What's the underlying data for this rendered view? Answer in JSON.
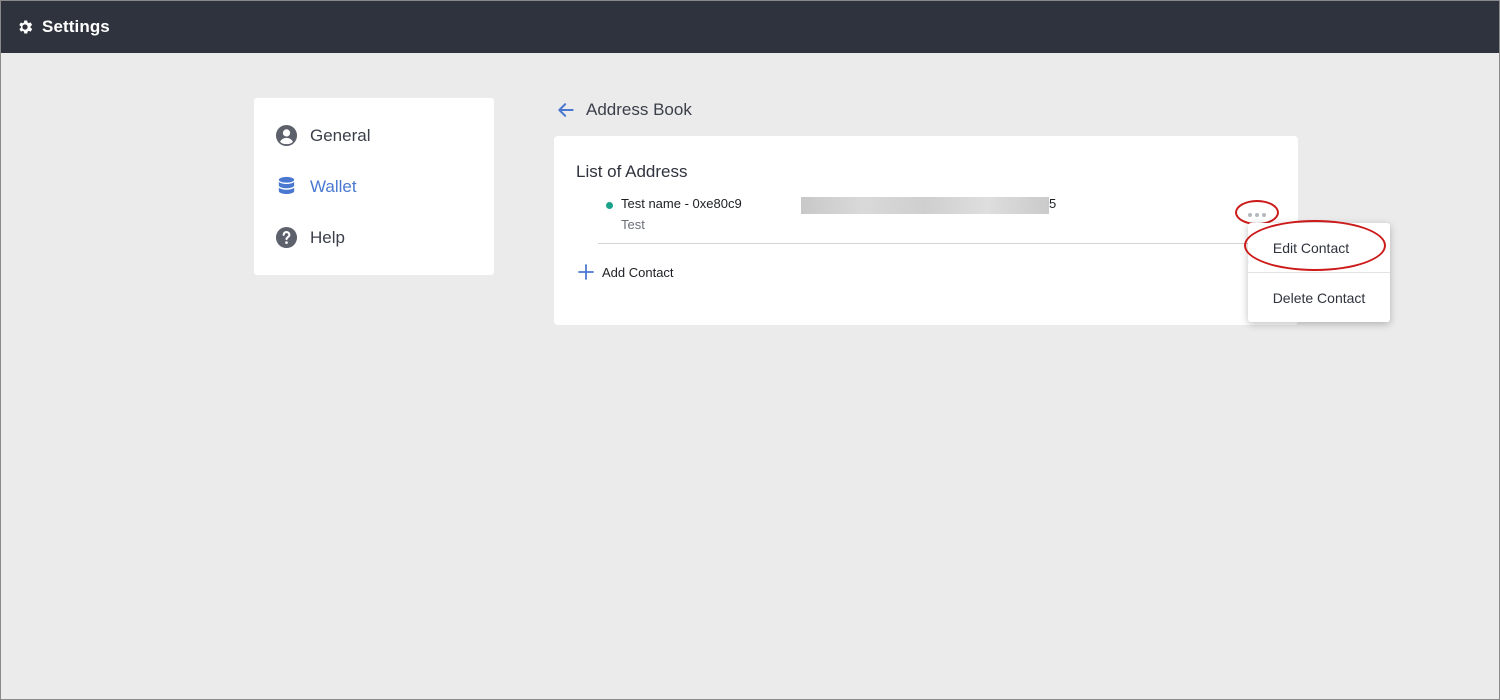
{
  "app": {
    "title": "Settings",
    "icon": "gear-icon"
  },
  "sidebar": {
    "items": [
      {
        "label": "General",
        "icon": "user-circle-icon",
        "active": false
      },
      {
        "label": "Wallet",
        "icon": "database-icon",
        "active": true
      },
      {
        "label": "Help",
        "icon": "question-circle-icon",
        "active": false
      }
    ]
  },
  "page": {
    "title": "Address Book",
    "back_icon": "arrow-left-icon"
  },
  "address_list": {
    "title": "List of Address",
    "entries": [
      {
        "name_prefix": "Test name - 0xe80c9",
        "name_suffix": "5",
        "note": "Test",
        "status_color": "#1aa38a"
      }
    ],
    "add_label": "Add Contact"
  },
  "context_menu": {
    "items": [
      "Edit Contact",
      "Delete Contact"
    ]
  },
  "colors": {
    "accent": "#4a78d1",
    "topbar": "#2f333d",
    "highlight": "#cc1a1a"
  }
}
